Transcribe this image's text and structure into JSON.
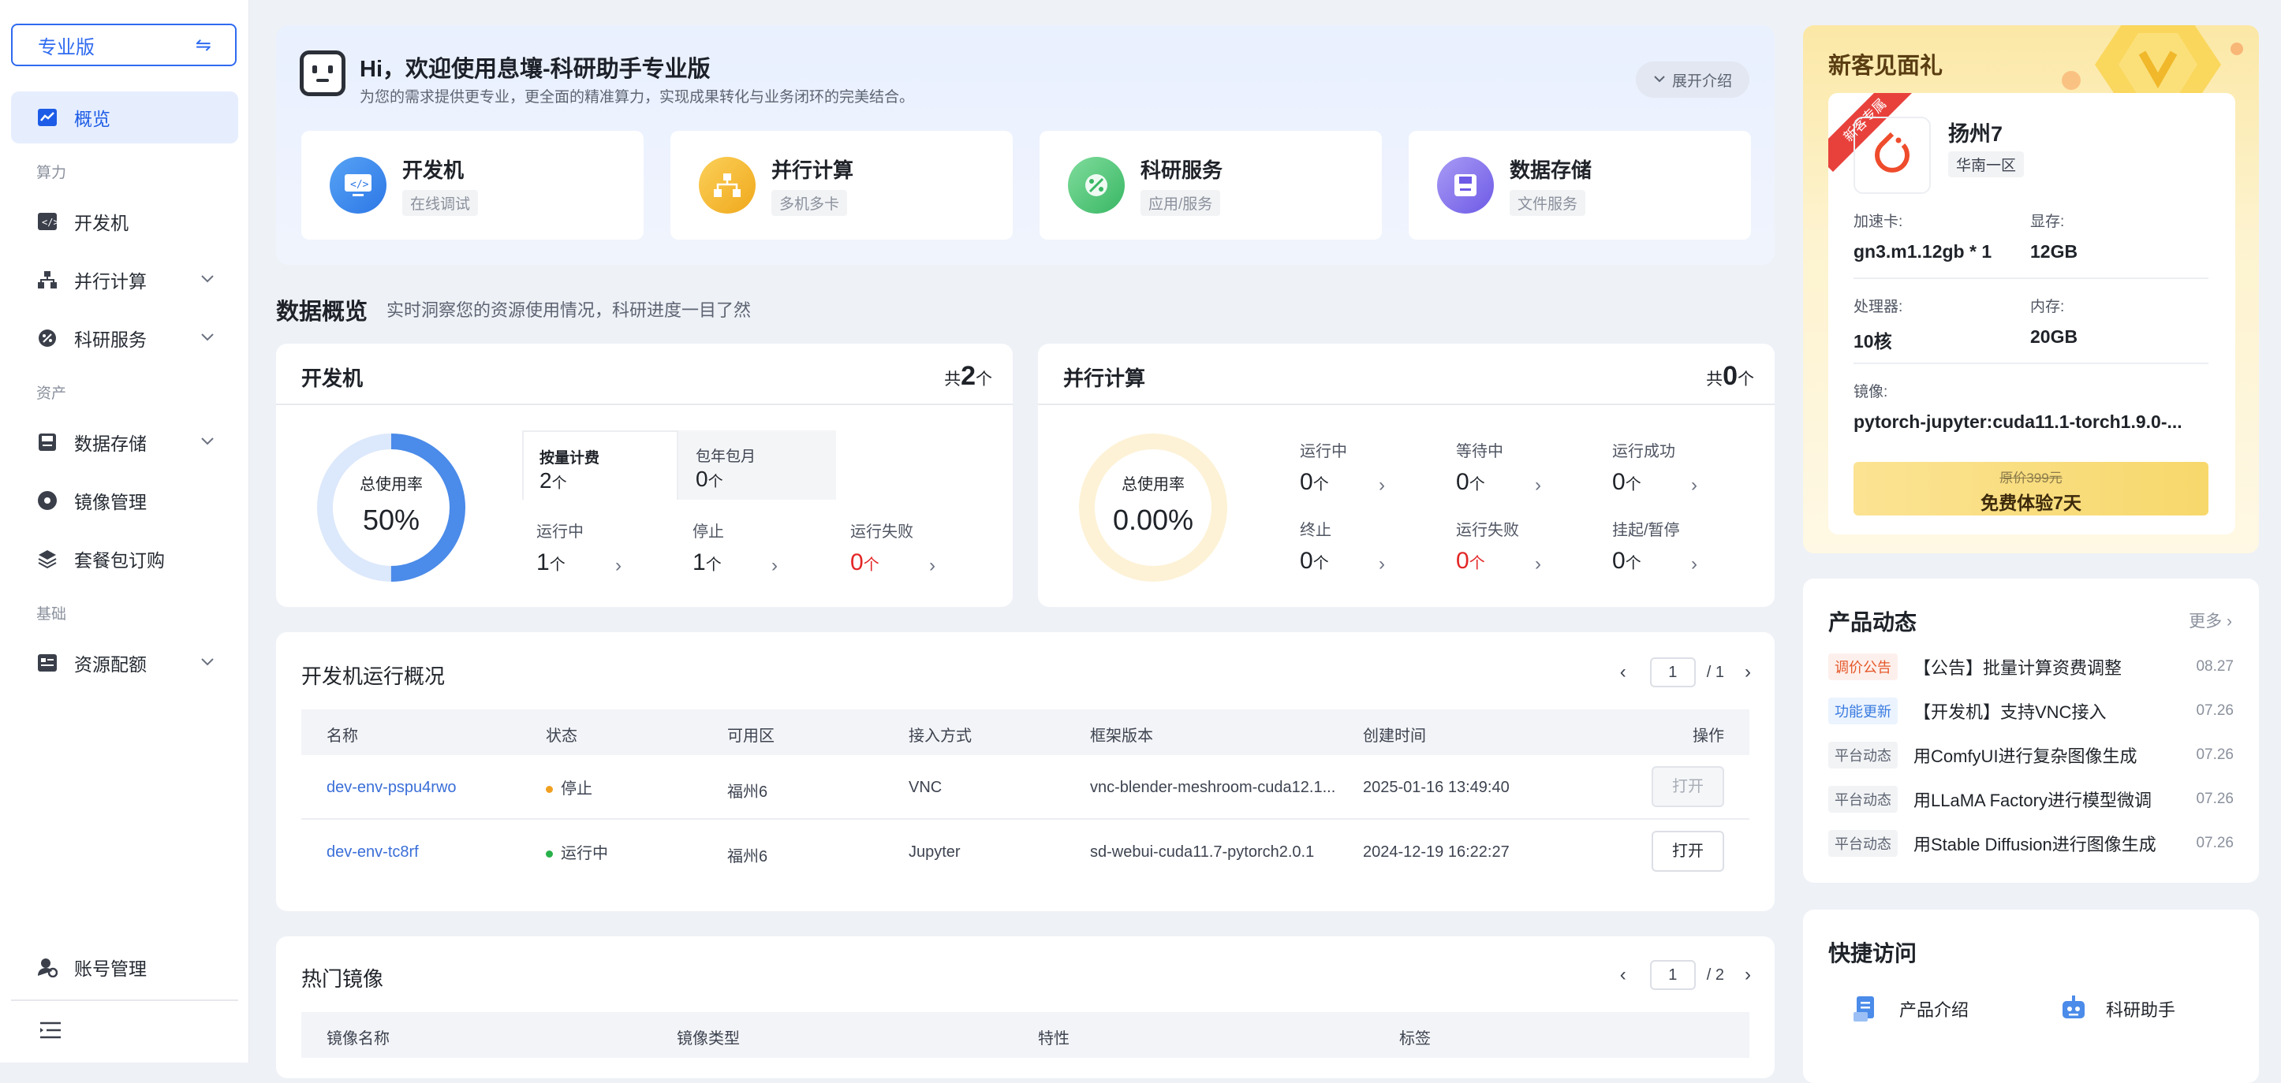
{
  "sidebar": {
    "edition": "专业版",
    "items": [
      {
        "label": "概览"
      },
      {
        "label": "开发机"
      },
      {
        "label": "并行计算"
      },
      {
        "label": "科研服务"
      },
      {
        "label": "数据存储"
      },
      {
        "label": "镜像管理"
      },
      {
        "label": "套餐包订购"
      },
      {
        "label": "资源配额"
      },
      {
        "label": "账号管理"
      }
    ],
    "groups": {
      "compute": "算力",
      "assets": "资产",
      "basic": "基础"
    }
  },
  "banner": {
    "title": "Hi，欢迎使用息壤-科研助手专业版",
    "subtitle": "为您的需求提供更专业，更全面的精准算力，实现成果转化与业务闭环的完美结合。",
    "expand": "展开介绍",
    "features": [
      {
        "title": "开发机",
        "sub": "在线调试"
      },
      {
        "title": "并行计算",
        "sub": "多机多卡"
      },
      {
        "title": "科研服务",
        "sub": "应用/服务"
      },
      {
        "title": "数据存储",
        "sub": "文件服务"
      }
    ]
  },
  "overview": {
    "title": "数据概览",
    "subtitle": "实时洞察您的资源使用情况，科研进度一目了然"
  },
  "devcard": {
    "title": "开发机",
    "total_prefix": "共",
    "total": "2",
    "unit": "个",
    "usage_label": "总使用率",
    "usage": "50%",
    "usage_fraction": 0.5,
    "tabs": [
      "按量计费",
      "包年包月"
    ],
    "tab_values": [
      "2",
      "0"
    ],
    "stats": [
      {
        "label": "运行中",
        "value": "1"
      },
      {
        "label": "停止",
        "value": "1"
      },
      {
        "label": "运行失败",
        "value": "0"
      }
    ]
  },
  "parcard": {
    "title": "并行计算",
    "total_prefix": "共",
    "total": "0",
    "unit": "个",
    "usage_label": "总使用率",
    "usage": "0.00%",
    "usage_fraction": 0,
    "stats": [
      {
        "label": "运行中",
        "value": "0"
      },
      {
        "label": "等待中",
        "value": "0"
      },
      {
        "label": "运行成功",
        "value": "0"
      },
      {
        "label": "终止",
        "value": "0"
      },
      {
        "label": "运行失败",
        "value": "0"
      },
      {
        "label": "挂起/暂停",
        "value": "0"
      }
    ]
  },
  "devtable": {
    "title": "开发机运行概况",
    "page": "1",
    "pages": "/ 1",
    "headers": [
      "名称",
      "状态",
      "可用区",
      "接入方式",
      "框架版本",
      "创建时间",
      "操作"
    ],
    "rows": [
      {
        "name": "dev-env-pspu4rwo",
        "status": "停止",
        "zone": "福州6",
        "access": "VNC",
        "framework": "vnc-blender-meshroom-cuda12.1...",
        "created": "2025-01-16 13:49:40",
        "action": "打开"
      },
      {
        "name": "dev-env-tc8rf",
        "status": "运行中",
        "zone": "福州6",
        "access": "Jupyter",
        "framework": "sd-webui-cuda11.7-pytorch2.0.1",
        "created": "2024-12-19 16:22:27",
        "action": "打开"
      }
    ],
    "status_colors": {
      "stopped": "#f0a020",
      "running": "#27b14a"
    }
  },
  "hotimages": {
    "title": "热门镜像",
    "page": "1",
    "pages": "/ 2",
    "headers": [
      "镜像名称",
      "镜像类型",
      "特性",
      "标签"
    ]
  },
  "gift": {
    "title": "新客见面礼",
    "ribbon": "新客专属",
    "name": "扬州7",
    "region": "华南一区",
    "acc_label": "加速卡:",
    "acc": "gn3.m1.12gb * 1",
    "vram_label": "显存:",
    "vram": "12GB",
    "cpu_label": "处理器:",
    "cpu": "10核",
    "mem_label": "内存:",
    "mem": "20GB",
    "image_label": "镜像:",
    "image": "pytorch-jupyter:cuda11.1-torch1.9.0-...",
    "orig_price": "原价399元",
    "cta": "免费体验7天"
  },
  "news": {
    "title": "产品动态",
    "more": "更多",
    "items": [
      {
        "tag": "调价公告",
        "text": "【公告】批量计算资费调整",
        "date": "08.27"
      },
      {
        "tag": "功能更新",
        "text": "【开发机】支持VNC接入",
        "date": "07.26"
      },
      {
        "tag": "平台动态",
        "text": "用ComfyUI进行复杂图像生成",
        "date": "07.26"
      },
      {
        "tag": "平台动态",
        "text": "用LLaMA Factory进行模型微调",
        "date": "07.26"
      },
      {
        "tag": "平台动态",
        "text": "用Stable Diffusion进行图像生成",
        "date": "07.26"
      }
    ]
  },
  "quick": {
    "title": "快捷访问",
    "items": [
      "产品介绍",
      "科研助手"
    ]
  },
  "colors": {
    "accent": "#2f6bf0",
    "danger": "#e32525",
    "link": "#3a6fd8"
  }
}
